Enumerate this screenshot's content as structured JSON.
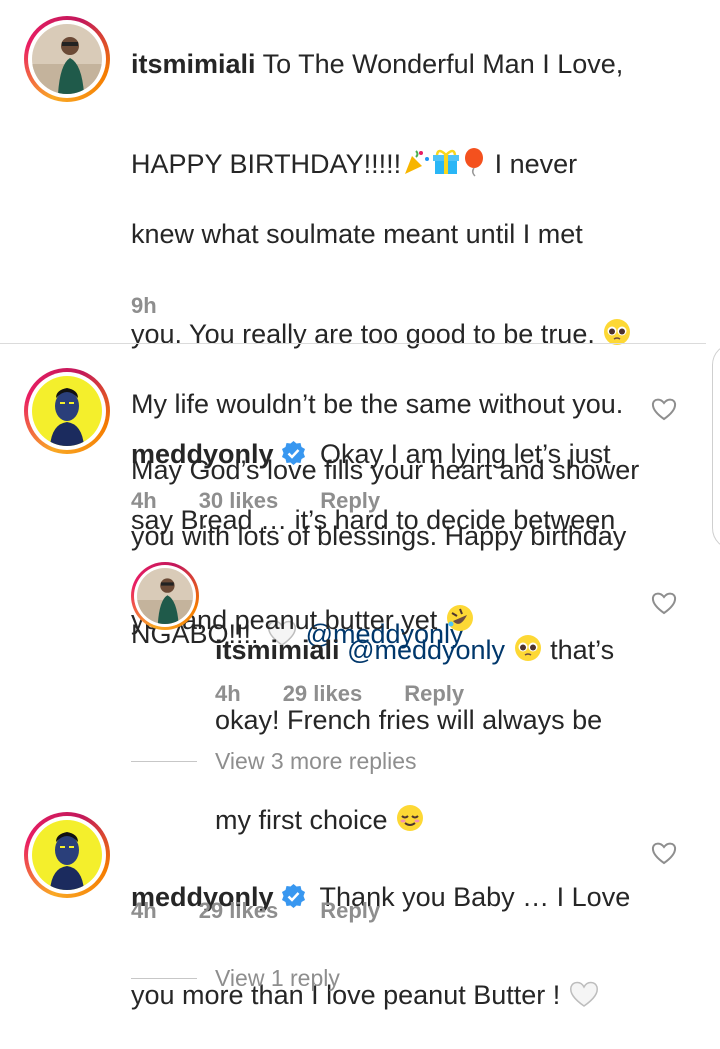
{
  "caption": {
    "username": "itsmimiali",
    "line1": "To The Wonderful Man I Love,",
    "line2": "HAPPY BIRTHDAY!!!!!",
    "line2_after": "I never",
    "line3": "knew what soulmate meant until I met",
    "line4": "you. You really are too good to be true.",
    "line5": "My life wouldn’t be the same without you.",
    "line6": "May God’s love fills your heart and shower",
    "line7": "you with lots of  blessings. Happy birthday",
    "line8": "NGABO!!!.",
    "mention": "@meddyonly",
    "time": "9h"
  },
  "comments": [
    {
      "username": "meddyonly",
      "text_line1": "Okay I am lying let’s just",
      "text_line2": "say Bread … it’s hard to decide between",
      "text_line3": "you and peanut butter yet",
      "time": "4h",
      "likes": "30 likes",
      "reply": "Reply"
    },
    {
      "username": "itsmimiali",
      "mention": "@meddyonly",
      "text_line1": "that’s",
      "text_line2": "okay! French fries will always be",
      "text_line3": "my first choice",
      "time": "4h",
      "likes": "29 likes",
      "reply": "Reply"
    },
    {
      "username": "meddyonly",
      "text_line1": "Thank you Baby … I Love",
      "text_line2": "you more than I love peanut Butter !",
      "time": "4h",
      "likes": "29 likes",
      "reply": "Reply"
    }
  ],
  "view_more_replies": "View 3 more replies",
  "view_1_reply": "View 1 reply",
  "colors": {
    "text": "#262626",
    "secondary": "#8e8e8e",
    "mention": "#00376b",
    "verified": "#3897f0"
  }
}
